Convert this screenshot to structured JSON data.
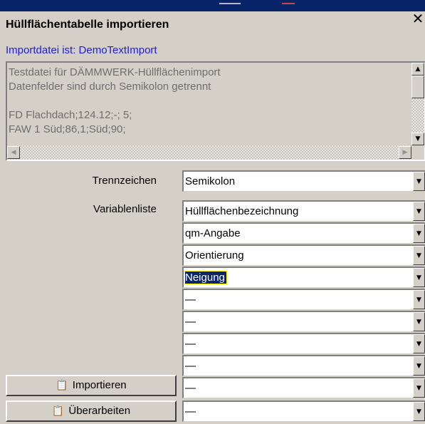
{
  "window": {
    "title": "Hüllflächentabelle importieren",
    "close_glyph": "✕"
  },
  "import_file": "Importdatei ist: DemoTextImport",
  "preview": {
    "lines": [
      "Testdatei für DÄMMWERK-Hüllflächenimport",
      "Datenfelder sind durch Semikolon getrennt",
      "",
      "FD Flachdach;124.12;-; 5;",
      "FAW 1 Süd;86,1;Süd;90;"
    ]
  },
  "separator": {
    "label": "Trennzeichen",
    "value": "Semikolon"
  },
  "variables": {
    "label": "Variablenliste",
    "items": [
      "Hüllflächenbezeichnung",
      "qm-Angabe",
      "Orientierung",
      "Neigung",
      "—",
      "—",
      "—",
      "—",
      "—",
      "—"
    ],
    "selected_index": 3
  },
  "buttons": {
    "import": "Importieren",
    "revise": "Überarbeiten"
  },
  "icons": {
    "button_icon": "paste-icon",
    "dropdown": "triangle-down-icon",
    "scroll_up": "triangle-up-icon",
    "scroll_down": "triangle-down-icon",
    "scroll_left": "triangle-left-icon",
    "scroll_right": "triangle-right-icon"
  },
  "colors": {
    "title_bar": "#0a246a",
    "selection": "#0a246a",
    "import_file_text": "#1c1ce6",
    "dialog_bg": "#d4d0c8"
  }
}
